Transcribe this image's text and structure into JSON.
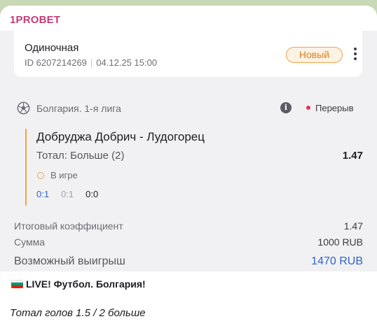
{
  "channel": {
    "name": "1PROBET"
  },
  "ticket": {
    "type": "Одиночная",
    "id_text": "ID 6207214269",
    "datetime": "04.12.25 15:00",
    "badge": "Новый"
  },
  "event": {
    "league": "Болгария. 1-я лига",
    "status": "Перерыв",
    "teams": "Добруджа Добрич - Лудогорец",
    "market": "Тотал: Больше (2)",
    "odds": "1.47",
    "state": "В игре",
    "scores": [
      "0:1",
      "0:1",
      "0:0"
    ]
  },
  "summary": {
    "total_odds_label": "Итоговый коэффициент",
    "total_odds_value": "1.47",
    "stake_label": "Сумма",
    "stake_value": "1000 RUB",
    "payout_label": "Возможный выигрыш",
    "payout_value": "1470 RUB"
  },
  "caption": {
    "headline": "LIVE! Футбол. Болгария!",
    "note": "Тотал голов 1.5 / 2 больше"
  },
  "colors": {
    "channel": "#c23d76",
    "accent_orange": "#f0a54a",
    "accent_blue": "#2f62c9",
    "live_red": "#e6334e",
    "card_bg": "#f1f1f4"
  },
  "icons": [
    "soccer-ball-icon",
    "info-icon",
    "kebab-menu-icon",
    "bulgaria-flag-icon"
  ]
}
